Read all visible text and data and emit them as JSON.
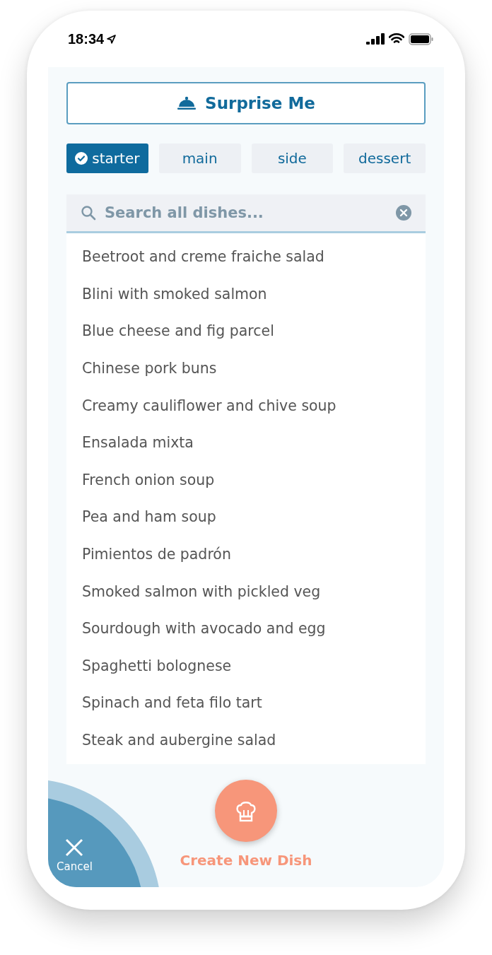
{
  "status_bar": {
    "time": "18:34"
  },
  "surprise_button": {
    "label": "Surprise Me"
  },
  "categories": [
    {
      "label": "starter",
      "selected": true
    },
    {
      "label": "main",
      "selected": false
    },
    {
      "label": "side",
      "selected": false
    },
    {
      "label": "dessert",
      "selected": false
    }
  ],
  "search": {
    "placeholder": "Search all dishes..."
  },
  "dishes": [
    "Beetroot and creme fraiche salad",
    "Blini with smoked salmon",
    "Blue cheese and fig parcel",
    "Chinese pork buns",
    "Creamy cauliflower and chive soup",
    "Ensalada mixta",
    "French onion soup",
    "Pea and ham soup",
    "Pimientos de padrón",
    "Smoked salmon with pickled veg",
    "Sourdough with avocado and egg",
    "Spaghetti bolognese",
    "Spinach and feta filo tart",
    "Steak and aubergine salad"
  ],
  "create_button": {
    "label": "Create New Dish"
  },
  "cancel_button": {
    "label": "Cancel"
  }
}
